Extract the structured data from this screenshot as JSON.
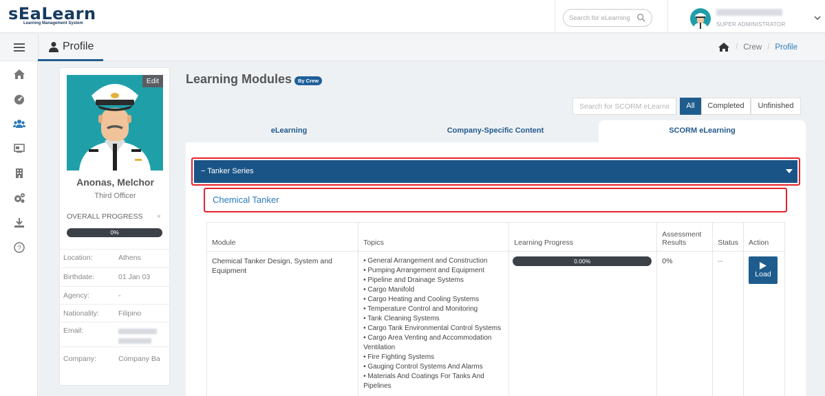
{
  "app": {
    "logo_part1": "sEa",
    "logo_part2": "Learn",
    "logo_sub": "Learning Management System",
    "search_placeholder": "Search for eLearning",
    "user_role": "SUPER ADMINISTRATOR"
  },
  "subheader": {
    "title": "Profile",
    "breadcrumb": [
      "Crew",
      "Profile"
    ]
  },
  "sidebar": {
    "icons": [
      "home-icon",
      "dashboard-icon",
      "users-icon",
      "screen-icon",
      "building-icon",
      "cogs-icon",
      "download-icon",
      "help-icon"
    ]
  },
  "profile": {
    "edit_label": "Edit",
    "name": "Anonas, Melchor",
    "rank": "Third Officer",
    "progress_label": "OVERALL PROGRESS",
    "progress_close": "×",
    "progress_value": "0%",
    "info": [
      {
        "label": "Location:",
        "value": "Athens"
      },
      {
        "label": "Birthdate:",
        "value": "01 Jan 03"
      },
      {
        "label": "Agency:",
        "value": "-"
      },
      {
        "label": "Nationality:",
        "value": "Filipino"
      },
      {
        "label": "Email:",
        "value": ""
      },
      {
        "label": "Company:",
        "value": "Company Ba"
      }
    ]
  },
  "modules": {
    "title": "Learning Modules",
    "badge": "By Crew",
    "search_placeholder": "Search for SCORM eLearning",
    "filters": [
      "All",
      "Completed",
      "Unfinished"
    ],
    "tabs": [
      "eLearning",
      "Company-Specific Content",
      "SCORM eLearning"
    ],
    "series": "Tanker Series",
    "series_collapse": "−",
    "subseries": "Chemical Tanker",
    "table": {
      "headers": [
        "Module",
        "Topics",
        "Learning Progress",
        "Assessment Results",
        "Status",
        "Action"
      ],
      "row": {
        "module": "Chemical Tanker Design, System and Equipment",
        "topics": [
          "• General Arrangement and Construction",
          "• Pumping Arrangement and Equipment",
          "• Pipeline and Drainage Systems",
          "• Cargo Manifold",
          "• Cargo Heating and Cooling Systems",
          "• Temperature Control and Monitoring",
          "• Tank Cleaning Systems",
          "• Cargo Tank Environmental Control Systems",
          "• Cargo Area Venting and Accommodation Ventilation",
          "• Fire Fighting Systems",
          "• Gauging Control Systems And Alarms",
          "• Materials And Coatings For Tanks And Pipelines"
        ],
        "progress": "0.00%",
        "assessment": "0%",
        "status": "--",
        "action": "Load"
      }
    }
  }
}
